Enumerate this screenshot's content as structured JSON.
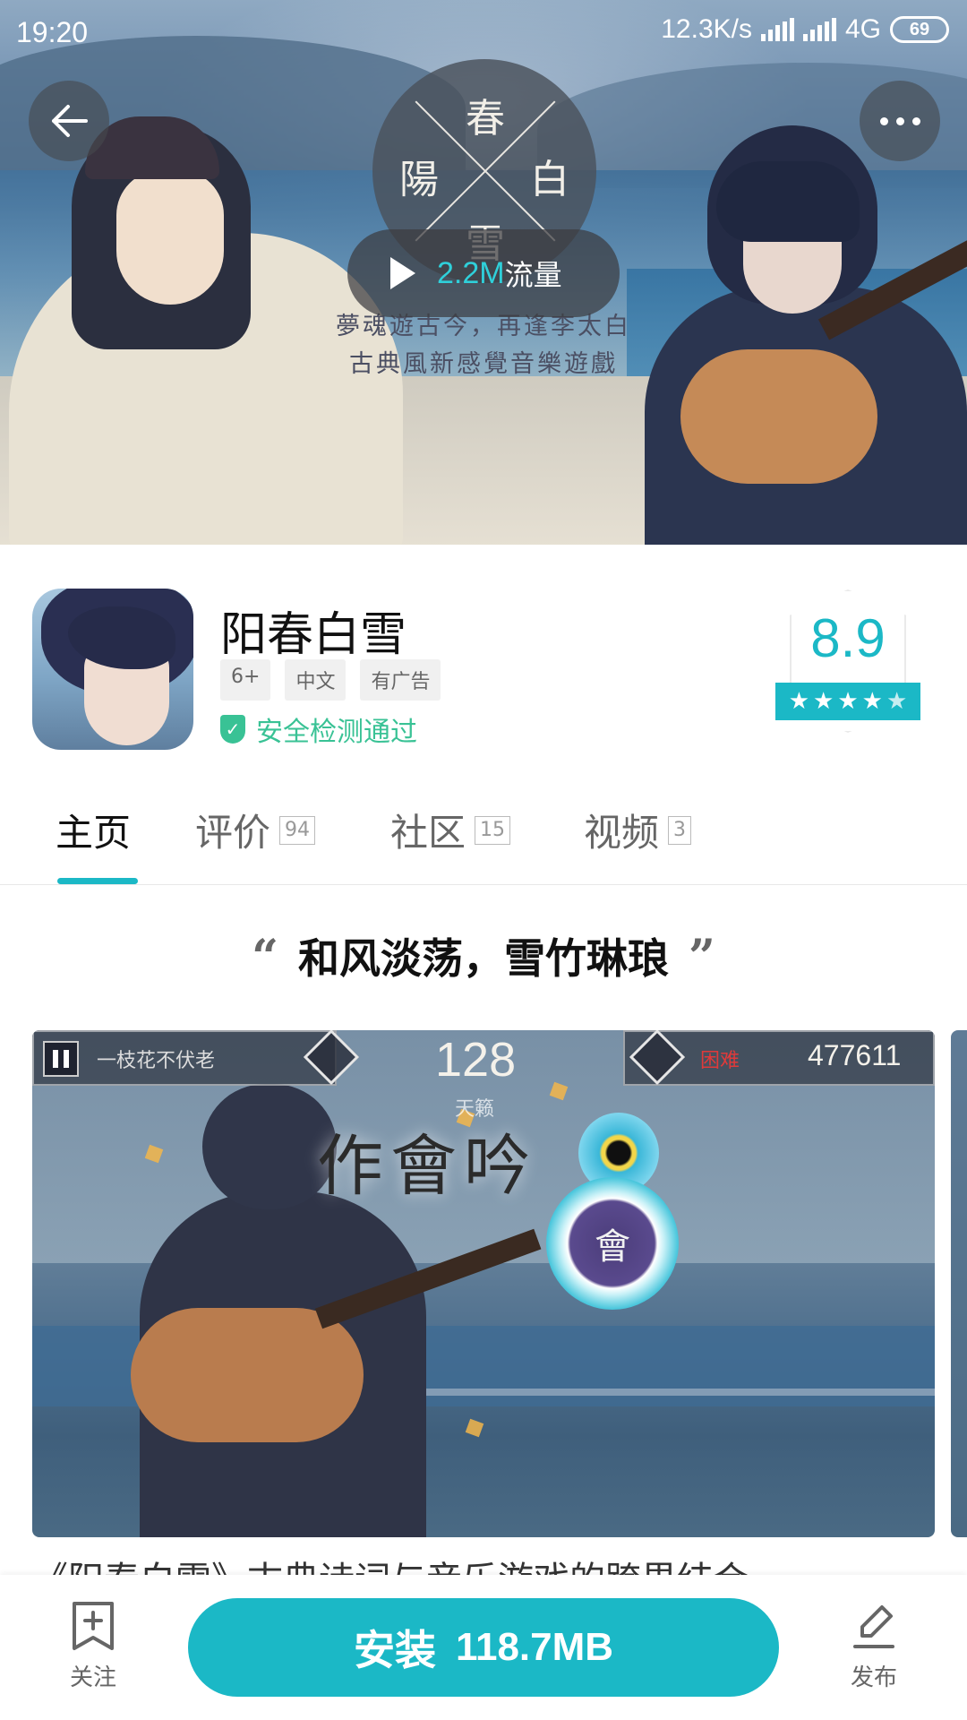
{
  "status_bar": {
    "time": "19:20",
    "network_speed": "12.3K/s",
    "network_type": "4G",
    "battery": "69"
  },
  "hero": {
    "logo_chars": [
      "春",
      "陽",
      "白",
      "雪"
    ],
    "tagline_line1": "夢魂遊古今，再逢李太白",
    "tagline_line2": "古典風新感覺音樂遊戲",
    "video_traffic_size": "2.2M",
    "video_traffic_unit": "流量"
  },
  "app": {
    "title": "阳春白雪",
    "tags": [
      "6+",
      "中文",
      "有广告"
    ],
    "safety_text": "安全检测通过",
    "rating": "8.9",
    "rating_stars": 4.5
  },
  "tabs": [
    {
      "label": "主页",
      "count": ""
    },
    {
      "label": "评价",
      "count": "94"
    },
    {
      "label": "社区",
      "count": "15"
    },
    {
      "label": "视频",
      "count": "3"
    }
  ],
  "content": {
    "quote": "和风淡荡，雪竹琳琅",
    "open_quote": "“",
    "close_quote": "”",
    "game_hud": {
      "song": "一枝花不伏老",
      "combo": "128",
      "combo_label": "天籁",
      "difficulty": "困难",
      "score": "477611",
      "lyric": "作會吟",
      "note_char": "會"
    },
    "description_peek": "《阳春白雪》古典诗词与音乐游戏的跨界结合……"
  },
  "bottom_bar": {
    "follow_label": "关注",
    "install_label": "安装",
    "install_size": "118.7MB",
    "publish_label": "发布"
  },
  "colors": {
    "accent": "#1bb8c6",
    "safe_green": "#39c295",
    "difficulty_red": "#e03a3a"
  },
  "icons": [
    "back-arrow-icon",
    "more-dots-icon",
    "play-icon",
    "shield-check-icon",
    "star-icon",
    "bookmark-plus-icon",
    "pencil-icon",
    "pause-icon",
    "signal-icon",
    "battery-icon"
  ]
}
